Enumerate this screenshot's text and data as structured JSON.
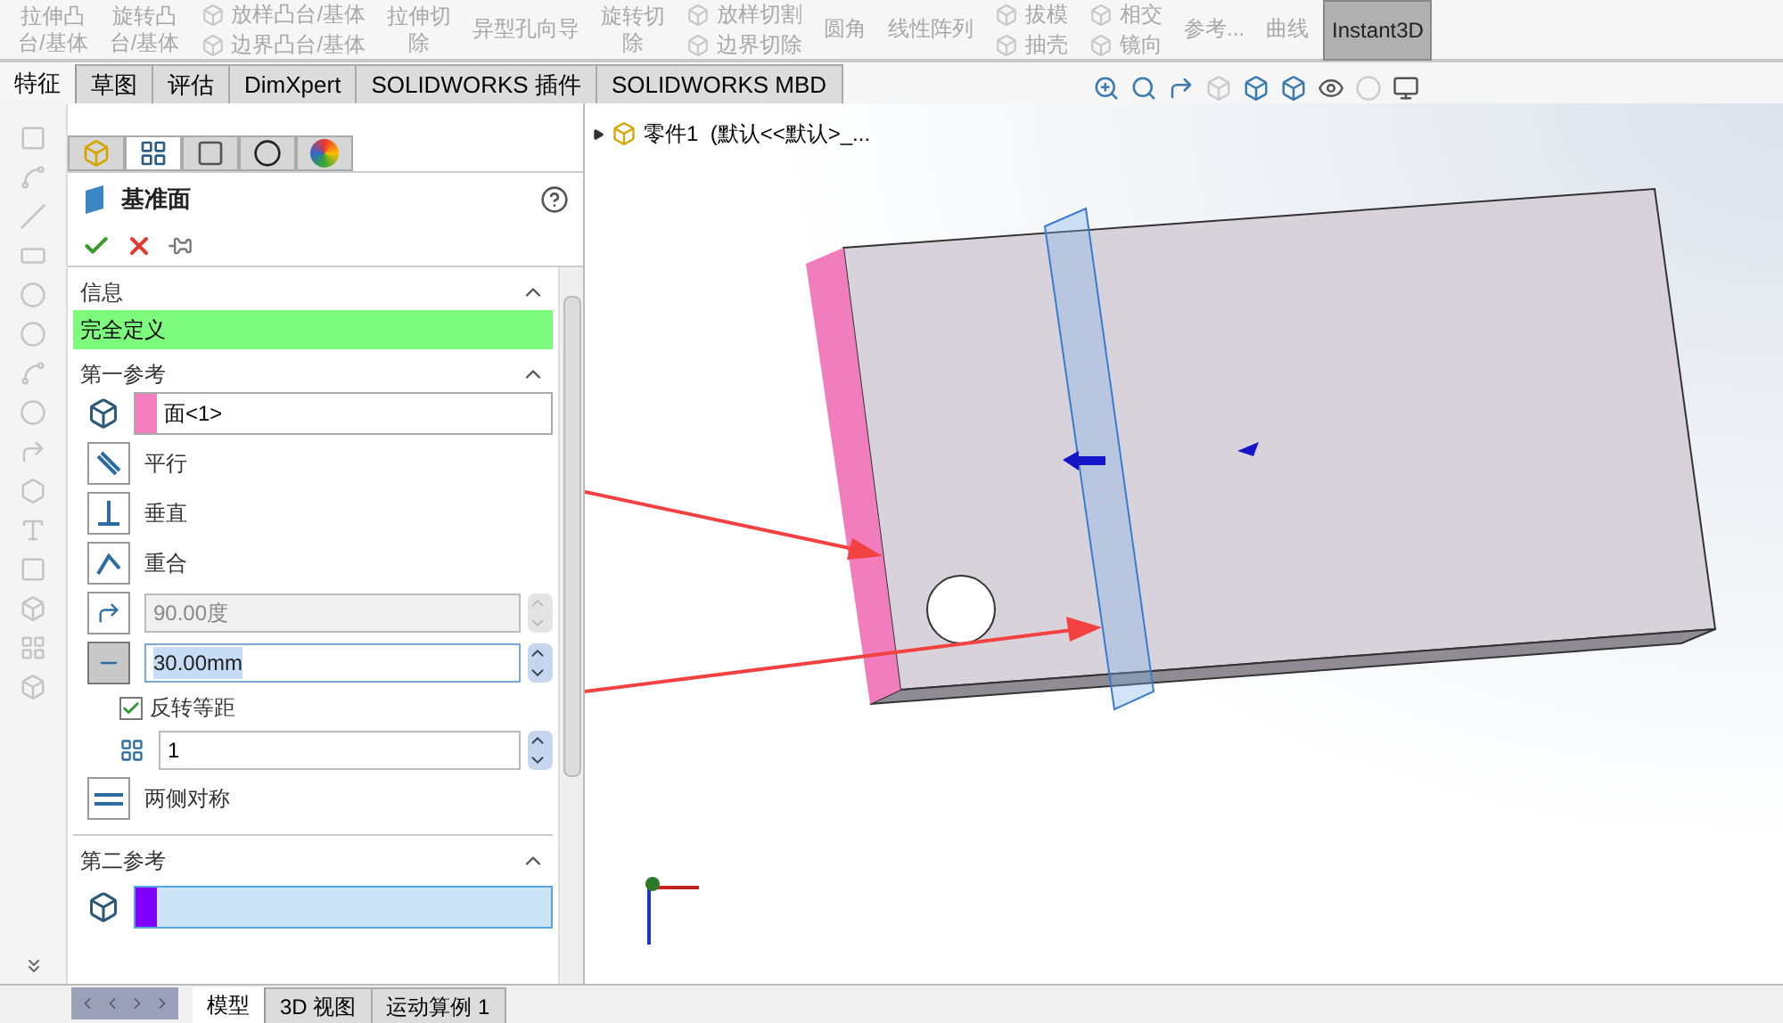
{
  "toolbar": {
    "items": [
      {
        "kind": "large",
        "lines": [
          "拉伸凸",
          "台/基体"
        ],
        "disabled": true
      },
      {
        "kind": "large",
        "lines": [
          "旋转凸",
          "台/基体"
        ],
        "disabled": true
      },
      {
        "kind": "small",
        "lines": [
          "放样凸台/基体",
          "边界凸台/基体"
        ],
        "disabled": true
      },
      {
        "kind": "large",
        "lines": [
          "拉伸切",
          "除"
        ],
        "disabled": true
      },
      {
        "kind": "large",
        "lines": [
          "异型孔向导"
        ],
        "disabled": true
      },
      {
        "kind": "large",
        "lines": [
          "旋转切",
          "除"
        ],
        "disabled": true
      },
      {
        "kind": "small",
        "lines": [
          "放样切割",
          "边界切除"
        ],
        "disabled": true
      },
      {
        "kind": "large",
        "lines": [
          "圆角"
        ],
        "disabled": true
      },
      {
        "kind": "large",
        "lines": [
          "线性阵列"
        ],
        "disabled": true
      },
      {
        "kind": "small",
        "lines": [
          "拔模",
          "抽壳"
        ],
        "disabled": true
      },
      {
        "kind": "small",
        "lines": [
          "相交",
          "镜向"
        ],
        "disabled": true
      },
      {
        "kind": "large",
        "lines": [
          "参考..."
        ],
        "disabled": true
      },
      {
        "kind": "large",
        "lines": [
          "曲线"
        ],
        "disabled": true
      },
      {
        "kind": "toggle",
        "lines": [
          "Instant3D"
        ],
        "selected": true
      }
    ]
  },
  "command_tabs": [
    {
      "label": "特征",
      "selected": true
    },
    {
      "label": "草图",
      "selected": false
    },
    {
      "label": "评估",
      "selected": false
    },
    {
      "label": "DimXpert",
      "selected": false
    },
    {
      "label": "SOLIDWORKS 插件",
      "selected": false
    },
    {
      "label": "SOLIDWORKS MBD",
      "selected": false
    }
  ],
  "panel_tabs": [
    {
      "kind": "feature",
      "selected": false
    },
    {
      "kind": "property",
      "selected": true
    },
    {
      "kind": "config",
      "selected": false
    },
    {
      "kind": "dimxpert",
      "selected": false
    },
    {
      "kind": "display",
      "selected": false
    }
  ],
  "property_manager": {
    "title": "基准面",
    "info": {
      "title": "信息",
      "message": "完全定义",
      "expanded": true
    },
    "first_reference": {
      "title": "第一参考",
      "expanded": true,
      "reference": "面<1>",
      "color": "#f47ec0",
      "constraints": [
        {
          "kind": "parallel",
          "label": "平行",
          "selected": false
        },
        {
          "kind": "perpendicular",
          "label": "垂直",
          "selected": false
        },
        {
          "kind": "coincident",
          "label": "重合",
          "selected": false
        }
      ],
      "angle": {
        "value": "90.00度",
        "disabled": true
      },
      "distance": {
        "value": "30.00mm",
        "disabled": false,
        "selected": true
      },
      "flip_offset": {
        "label": "反转等距",
        "checked": true
      },
      "count": {
        "value": "1"
      },
      "symmetric": {
        "label": "两侧对称",
        "selected": false
      }
    },
    "second_reference": {
      "title": "第二参考",
      "expanded": true,
      "color": "#8000ff"
    }
  },
  "feature_tree": {
    "part": "零件1  (默认<<默认>_..."
  },
  "bottom_tabs": [
    {
      "label": "模型",
      "selected": true
    },
    {
      "label": "3D 视图",
      "selected": false
    },
    {
      "label": "运动算例 1",
      "selected": false
    }
  ]
}
